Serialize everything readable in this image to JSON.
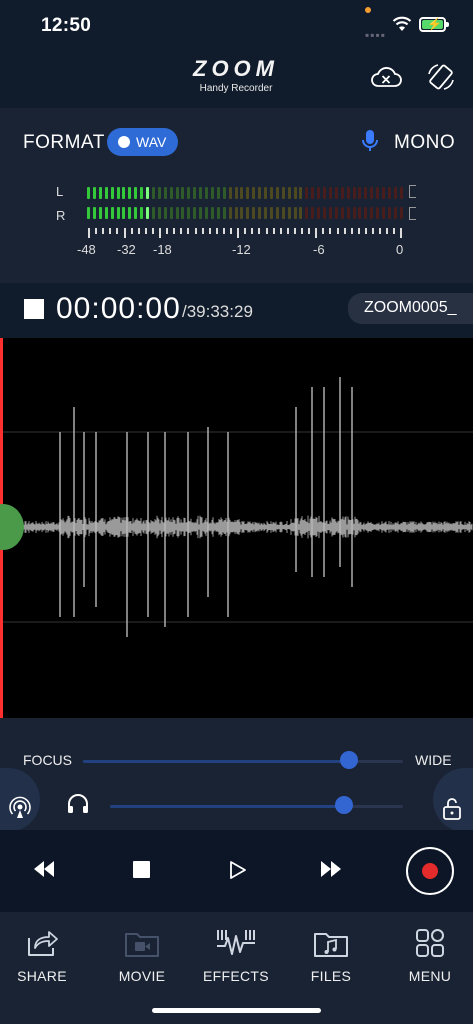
{
  "status": {
    "time": "12:50"
  },
  "header": {
    "brand": "ZOOM",
    "subtitle": "Handy Recorder"
  },
  "format": {
    "label": "FORMAT",
    "file_type": "WAV",
    "channel_mode": "MONO",
    "meter": {
      "channels": [
        "L",
        "R"
      ],
      "scale": [
        "-48",
        "-32",
        "-18",
        "-12",
        "-6",
        "0"
      ],
      "colors": {
        "green": "#33c93a",
        "dark_green": "#2f5a2a",
        "olive": "#4d4a22",
        "dark_red": "#4a1d1d"
      }
    }
  },
  "transport": {
    "elapsed": "00:00:00",
    "remaining": "/39:33:29",
    "filename": "ZOOM0005_"
  },
  "sliders": {
    "focus_label": "FOCUS",
    "wide_label": "WIDE",
    "focus_level": 0.83,
    "volume_level": 0.8
  },
  "colors": {
    "accent": "#3466d1",
    "record": "#e32b2b",
    "playhead": "#ff2f2f"
  },
  "tabs": [
    {
      "label": "SHARE",
      "icon": "share-icon"
    },
    {
      "label": "MOVIE",
      "icon": "movie-icon"
    },
    {
      "label": "EFFECTS",
      "icon": "effects-icon"
    },
    {
      "label": "FILES",
      "icon": "files-icon"
    },
    {
      "label": "MENU",
      "icon": "menu-icon"
    }
  ]
}
